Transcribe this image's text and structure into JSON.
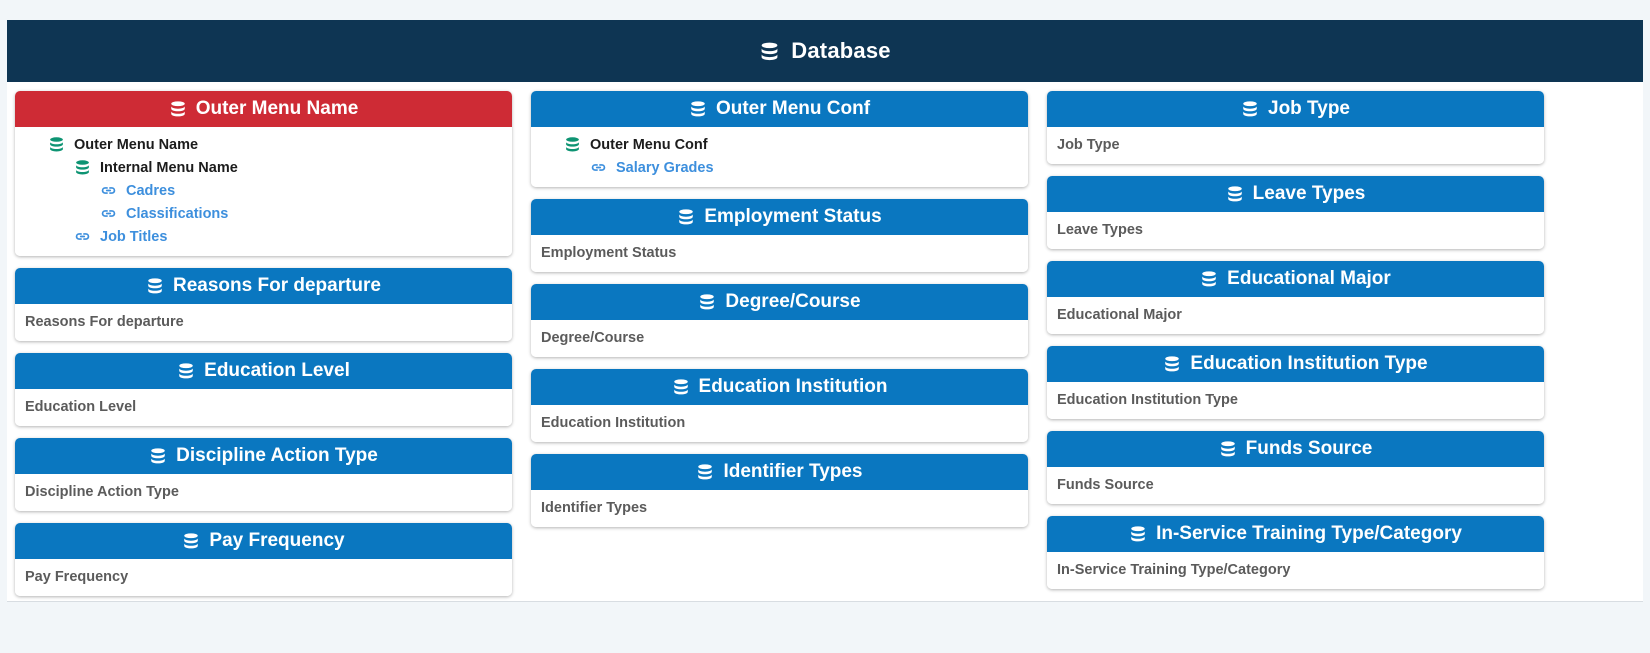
{
  "header": {
    "title": "Database",
    "icon": "database-icon",
    "bg_color": "#0e3553"
  },
  "colors": {
    "accent_blue": "#0a77c0",
    "accent_red": "#ce2b35",
    "tree_db_green": "#0e9473",
    "link_blue": "#3d8fdd",
    "page_bg": "#f2f6f9",
    "body_text": "#5b5b5b"
  },
  "columns": {
    "left": [
      {
        "title": "Outer Menu Name",
        "icon": "database-icon",
        "accent": "red",
        "type": "tree",
        "tree": [
          {
            "label": "Outer Menu Name",
            "icon": "database-icon",
            "level": 0,
            "kind": "node"
          },
          {
            "label": "Internal Menu Name",
            "icon": "database-icon",
            "level": 1,
            "kind": "node"
          },
          {
            "label": "Cadres",
            "icon": "link-icon",
            "level": 2,
            "kind": "link"
          },
          {
            "label": "Classifications",
            "icon": "link-icon",
            "level": 2,
            "kind": "link"
          },
          {
            "label": "Job Titles",
            "icon": "link-icon",
            "level": 1,
            "kind": "link"
          }
        ]
      },
      {
        "title": "Reasons For departure",
        "icon": "database-icon",
        "accent": "blue",
        "type": "label",
        "body": "Reasons For departure"
      },
      {
        "title": "Education Level",
        "icon": "database-icon",
        "accent": "blue",
        "type": "label",
        "body": "Education Level"
      },
      {
        "title": "Discipline Action Type",
        "icon": "database-icon",
        "accent": "blue",
        "type": "label",
        "body": "Discipline Action Type"
      },
      {
        "title": "Pay Frequency",
        "icon": "database-icon",
        "accent": "blue",
        "type": "label",
        "body": "Pay Frequency"
      }
    ],
    "middle": [
      {
        "title": "Outer Menu Conf",
        "icon": "database-icon",
        "accent": "blue",
        "type": "tree",
        "tree": [
          {
            "label": "Outer Menu Conf",
            "icon": "database-icon",
            "level": 0,
            "kind": "node"
          },
          {
            "label": "Salary Grades",
            "icon": "link-icon",
            "level": 1,
            "kind": "link"
          }
        ]
      },
      {
        "title": "Employment Status",
        "icon": "database-icon",
        "accent": "blue",
        "type": "label",
        "body": "Employment Status"
      },
      {
        "title": "Degree/Course",
        "icon": "database-icon",
        "accent": "blue",
        "type": "label",
        "body": "Degree/Course"
      },
      {
        "title": "Education Institution",
        "icon": "database-icon",
        "accent": "blue",
        "type": "label",
        "body": "Education Institution"
      },
      {
        "title": "Identifier Types",
        "icon": "database-icon",
        "accent": "blue",
        "type": "label",
        "body": "Identifier Types"
      }
    ],
    "right": [
      {
        "title": "Job Type",
        "icon": "database-icon",
        "accent": "blue",
        "type": "label",
        "body": "Job Type"
      },
      {
        "title": "Leave Types",
        "icon": "database-icon",
        "accent": "blue",
        "type": "label",
        "body": "Leave Types"
      },
      {
        "title": "Educational Major",
        "icon": "database-icon",
        "accent": "blue",
        "type": "label",
        "body": "Educational Major"
      },
      {
        "title": "Education Institution Type",
        "icon": "database-icon",
        "accent": "blue",
        "type": "label",
        "body": "Education Institution Type"
      },
      {
        "title": "Funds Source",
        "icon": "database-icon",
        "accent": "blue",
        "type": "label",
        "body": "Funds Source"
      },
      {
        "title": "In-Service Training Type/Category",
        "icon": "database-icon",
        "accent": "blue",
        "type": "label",
        "body": "In-Service Training Type/Category"
      }
    ]
  }
}
